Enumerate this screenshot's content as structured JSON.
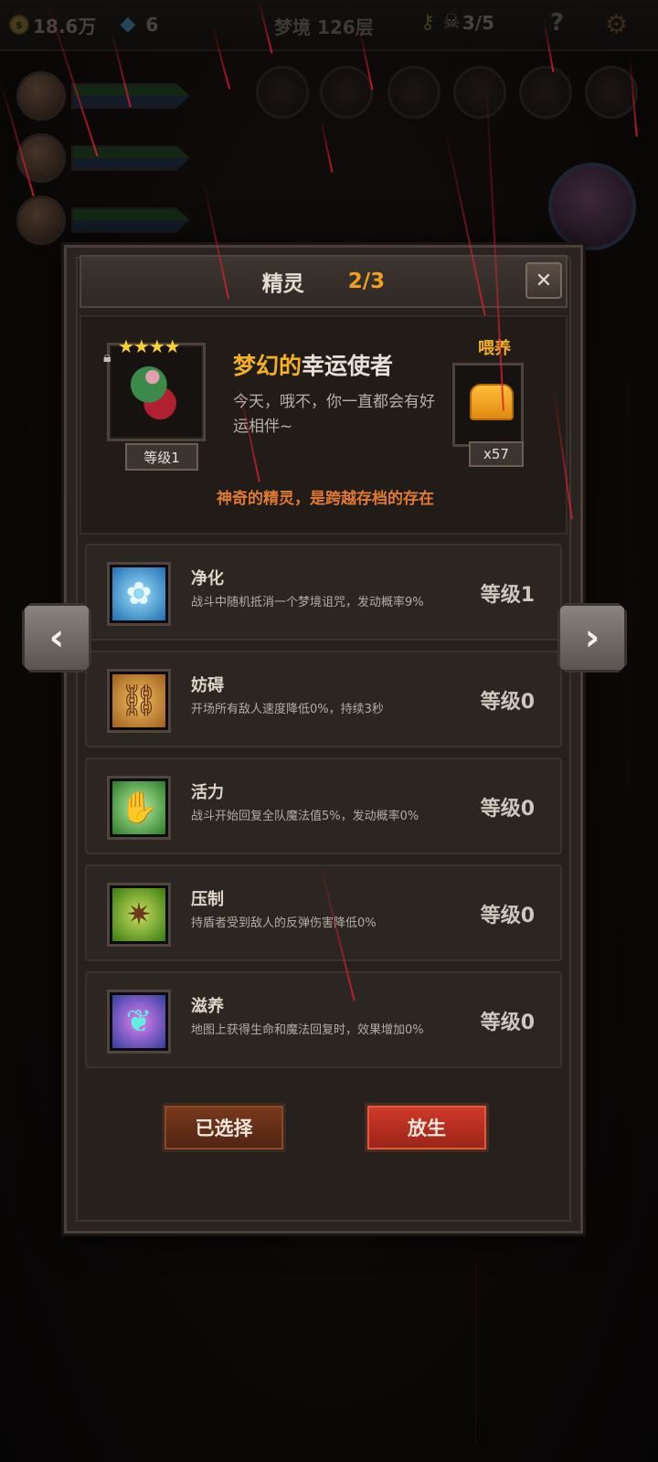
{
  "topbar": {
    "gold": "18.6万",
    "gems": "6",
    "floor": "梦境 126层",
    "skulls": "3/5",
    "help_icon": "question-icon",
    "gear_icon": "gear-icon"
  },
  "dialog": {
    "title": "精灵",
    "page_count": "2/3",
    "close_label": "✕",
    "spirit": {
      "stars": "★★★★",
      "level": "等级1",
      "name_prefix": "梦幻的",
      "name_main": "幸运使者",
      "description": "今天，哦不，你一直都会有好运相伴~",
      "feed_label": "喂养",
      "feed_count": "x57",
      "tagline": "神奇的精灵，是跨越存档的存在"
    },
    "skills": [
      {
        "name": "净化",
        "desc": "战斗中随机抵消一个梦境诅咒，发动概率9%",
        "level": "等级1",
        "icon": "blue-flower-icon"
      },
      {
        "name": "妨碍",
        "desc": "开场所有敌人速度降低0%，持续3秒",
        "level": "等级0",
        "icon": "chained-boot-icon"
      },
      {
        "name": "活力",
        "desc": "战斗开始回复全队魔法值5%，发动概率0%",
        "level": "等级0",
        "icon": "praying-hands-icon"
      },
      {
        "name": "压制",
        "desc": "持盾者受到敌人的反弹伤害降低0%",
        "level": "等级0",
        "icon": "claw-icon"
      },
      {
        "name": "滋养",
        "desc": "地图上获得生命和魔法回复时，效果增加0%",
        "level": "等级0",
        "icon": "fairy-wings-icon"
      }
    ],
    "buttons": {
      "selected": "已选择",
      "release": "放生"
    }
  },
  "nav": {
    "prev": "‹",
    "next": "›"
  }
}
